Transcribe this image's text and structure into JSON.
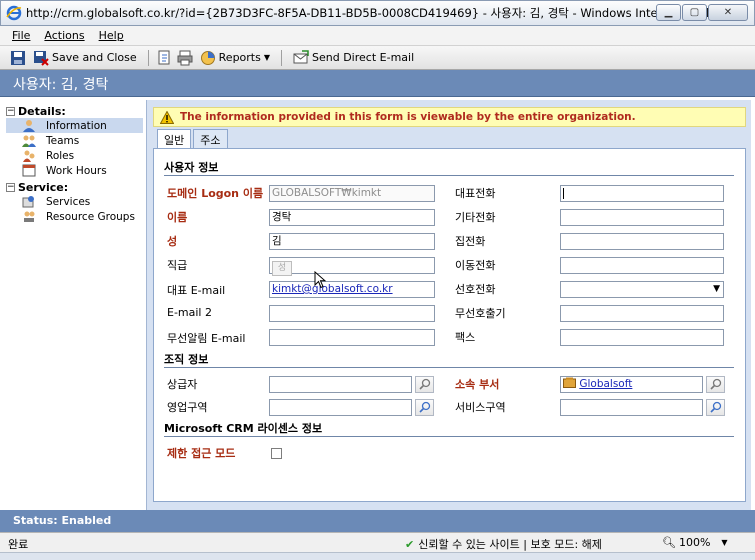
{
  "window": {
    "title": "http://crm.globalsoft.co.kr/?id={2B73D3FC-8F5A-DB11-BD5B-0008CD419469} - 사용자: 김, 경탁 - Windows Internet Explorer"
  },
  "menu": {
    "file": "File",
    "actions": "Actions",
    "help": "Help"
  },
  "toolbar": {
    "save_and_close": "Save and Close",
    "reports": "Reports",
    "send_email": "Send Direct E-mail"
  },
  "header": {
    "record_title": "사용자: 김, 경탁"
  },
  "nav": {
    "details_label": "Details:",
    "details_items": [
      {
        "label": "Information",
        "icon": "user-icon"
      },
      {
        "label": "Teams",
        "icon": "teams-icon"
      },
      {
        "label": "Roles",
        "icon": "roles-icon"
      },
      {
        "label": "Work Hours",
        "icon": "calendar-icon"
      }
    ],
    "service_label": "Service:",
    "service_items": [
      {
        "label": "Services",
        "icon": "services-icon"
      },
      {
        "label": "Resource Groups",
        "icon": "resource-groups-icon"
      }
    ]
  },
  "notice": "The information provided in this form is viewable by the entire organization.",
  "tabs": [
    "일반",
    "주소"
  ],
  "sections": {
    "user_info": "사용자 정보",
    "org_info": "조직 정보",
    "license_info": "Microsoft CRM 라이센스 정보"
  },
  "fields": {
    "domain_logon": {
      "label": "도메인 Logon 이름",
      "value": "GLOBALSOFT₩kimkt"
    },
    "first_name": {
      "label": "이름",
      "value": "경탁"
    },
    "last_name": {
      "label": "성",
      "value": "김"
    },
    "job_title": {
      "label": "직급",
      "value": ""
    },
    "primary_email": {
      "label": "대표 E-mail",
      "value": "kimkt@globalsoft.co.kr"
    },
    "email2": {
      "label": "E-mail 2",
      "value": ""
    },
    "mobile_alert_email": {
      "label": "무선알림 E-mail",
      "value": ""
    },
    "main_phone": {
      "label": "대표전화",
      "value": ""
    },
    "other_phone": {
      "label": "기타전화",
      "value": ""
    },
    "home_phone": {
      "label": "집전화",
      "value": ""
    },
    "mobile_phone": {
      "label": "이동전화",
      "value": ""
    },
    "preferred_phone": {
      "label": "선호전화",
      "value": ""
    },
    "pager": {
      "label": "무선호출기",
      "value": ""
    },
    "fax": {
      "label": "팩스",
      "value": ""
    },
    "manager": {
      "label": "상급자",
      "value": ""
    },
    "business_unit": {
      "label": "소속 부서",
      "value": "Globalsoft"
    },
    "sales_territory": {
      "label": "영업구역",
      "value": ""
    },
    "service_area": {
      "label": "서비스구역",
      "value": ""
    },
    "restricted_access": {
      "label": "제한 접근 모드",
      "checked": false
    }
  },
  "tooltip_text": "성",
  "status": {
    "text": "Status: Enabled"
  },
  "ie_status": {
    "done": "완료",
    "zone": "신뢰할 수 있는 사이트 | 보호 모드: 해제",
    "zoom": "100%"
  }
}
